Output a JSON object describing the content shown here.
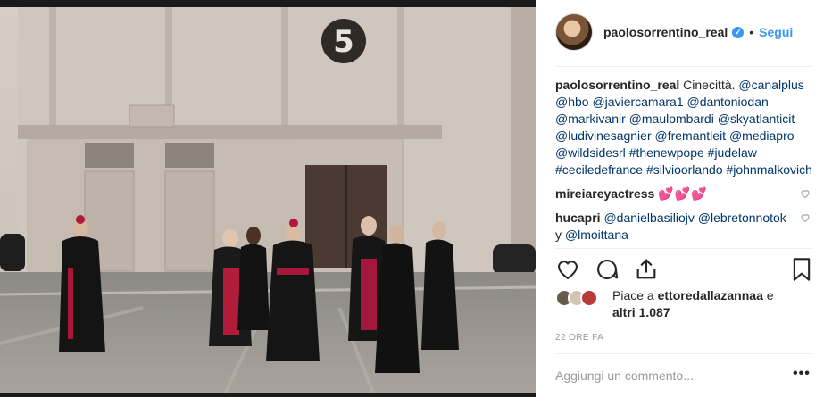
{
  "post": {
    "username": "paolosorrentino_real",
    "verified_icon": "verified-badge-icon",
    "separator": "•",
    "follow_label": "Segui",
    "badge_text": "5",
    "caption": {
      "author": "paolosorrentino_real",
      "text": "Cinecittà.",
      "tags": [
        "@canalplus",
        "@hbo",
        "@javiercamara1",
        "@dantoniodan",
        "@markivanir",
        "@maulombardi",
        "@skyatlanticit",
        "@ludivinesagnier",
        "@fremantleit",
        "@mediapro",
        "@wildsidesrl",
        "#thenewpope",
        "#judelaw",
        "#ceciledefrance",
        "#silvioorlando",
        "#johnmalkovich"
      ]
    },
    "comments": [
      {
        "author": "mireiareyactress",
        "text": "💕💕💕"
      },
      {
        "author": "hucapri",
        "mentions": [
          "@danielbasiliojv",
          "@lebretonnotok",
          "@lmoittana"
        ],
        "joiner": "y"
      }
    ],
    "likes": {
      "prefix": "Piace a",
      "user": "ettoredallazannaa",
      "conj": "e",
      "others": "altri 1.087"
    },
    "time": "22 ORE FA",
    "comment_placeholder": "Aggiungi un commento...",
    "more_label": "•••",
    "colors": {
      "link": "#003569",
      "follow": "#3897f0",
      "muted": "#999999",
      "text": "#262626"
    },
    "icons": [
      "heart-icon",
      "comment-icon",
      "share-icon",
      "bookmark-icon"
    ]
  }
}
